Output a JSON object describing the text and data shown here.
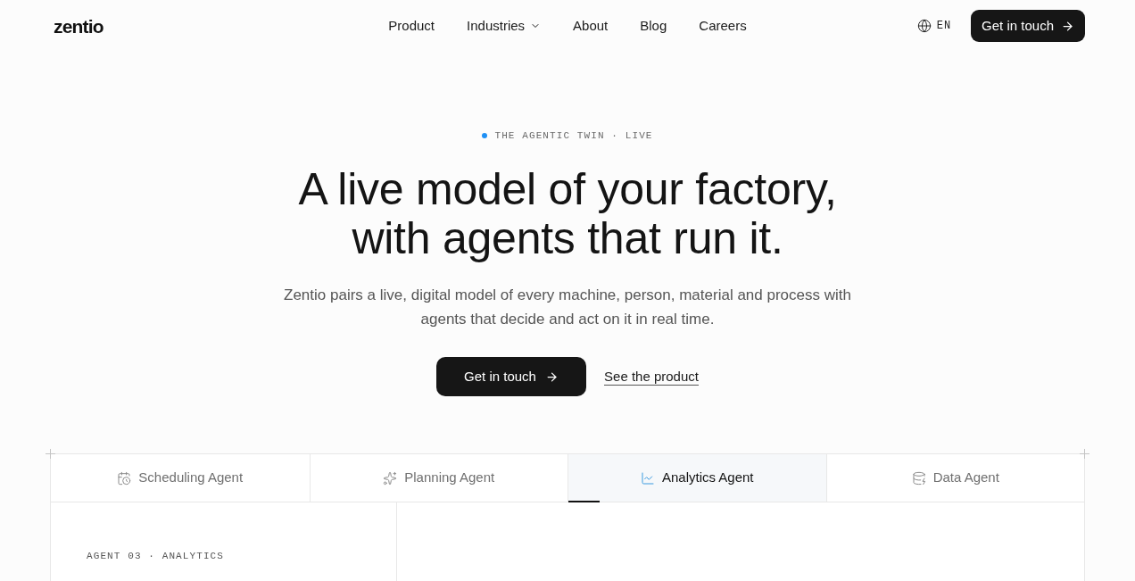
{
  "header": {
    "logo": "zentio",
    "nav": [
      {
        "label": "Product",
        "has_menu": false
      },
      {
        "label": "Industries",
        "has_menu": true
      },
      {
        "label": "About",
        "has_menu": false
      },
      {
        "label": "Blog",
        "has_menu": false
      },
      {
        "label": "Careers",
        "has_menu": false
      }
    ],
    "language": "EN",
    "cta": "Get in touch"
  },
  "hero": {
    "eyebrow": "THE AGENTIC TWIN · LIVE",
    "title_lines": [
      "A live model of your factory,",
      "with agents that run it."
    ],
    "subtitle_lines": [
      "Zentio pairs a live, digital model of every machine, person, material and process with",
      "agents that decide and act on it in real time."
    ],
    "primary_button": "Get in touch",
    "secondary_link": "See the product"
  },
  "agent_tabs": [
    {
      "label": "Scheduling Agent",
      "kind": "scheduling",
      "selected": false
    },
    {
      "label": "Planning Agent",
      "kind": "planning",
      "selected": false
    },
    {
      "label": "Analytics Agent",
      "kind": "analytics",
      "selected": true,
      "level": 0.12
    },
    {
      "label": "Data Agent",
      "kind": "data",
      "selected": false
    }
  ],
  "agent_panel": {
    "eyebrow": "AGENT 03 · ANALYTICS"
  }
}
